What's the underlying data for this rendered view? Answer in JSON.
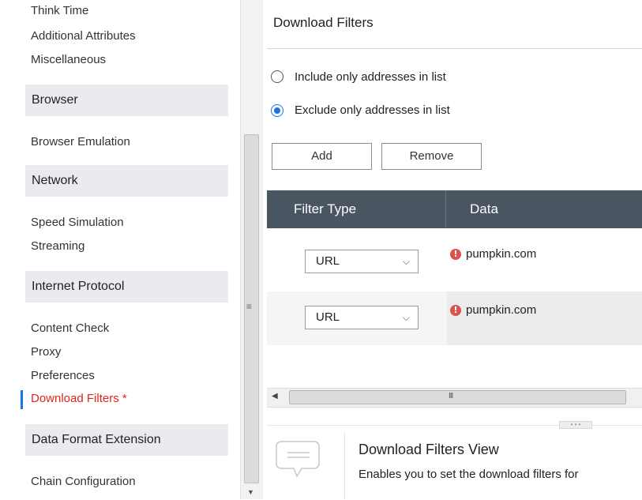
{
  "sidebar": {
    "top_links": [
      "Think Time",
      "Additional Attributes",
      "Miscellaneous"
    ],
    "sections": [
      {
        "title": "Browser",
        "items": [
          "Browser Emulation"
        ]
      },
      {
        "title": "Network",
        "items": [
          "Speed Simulation",
          "Streaming"
        ]
      },
      {
        "title": "Internet Protocol",
        "items": [
          "Content Check",
          "Proxy",
          "Preferences",
          "Download Filters *"
        ]
      },
      {
        "title": "Data Format Extension",
        "items": [
          "Chain Configuration"
        ]
      }
    ],
    "active_item": "Download Filters *"
  },
  "main": {
    "title": "Download Filters",
    "radios": [
      {
        "label": "Include only addresses in list",
        "checked": false
      },
      {
        "label": "Exclude only addresses in list",
        "checked": true
      }
    ],
    "buttons": {
      "add": "Add",
      "remove": "Remove"
    },
    "table": {
      "headers": [
        "Filter Type",
        "Data"
      ],
      "rows": [
        {
          "type": "URL",
          "data": "pumpkin.com"
        },
        {
          "type": "URL",
          "data": "pumpkin.com"
        }
      ]
    }
  },
  "help": {
    "title": "Download Filters View",
    "description": "Enables you to set the download filters for"
  },
  "icons": {
    "grip": "≡",
    "error": "!",
    "chevron": "⌵",
    "scroll_left": "◀",
    "scroll_down": "▼",
    "h_grip": "III",
    "more": "• • •"
  },
  "colors": {
    "accent": "#1a73e8",
    "active_text": "#e2231a",
    "table_header": "#4a5562",
    "error": "#d9534f"
  }
}
